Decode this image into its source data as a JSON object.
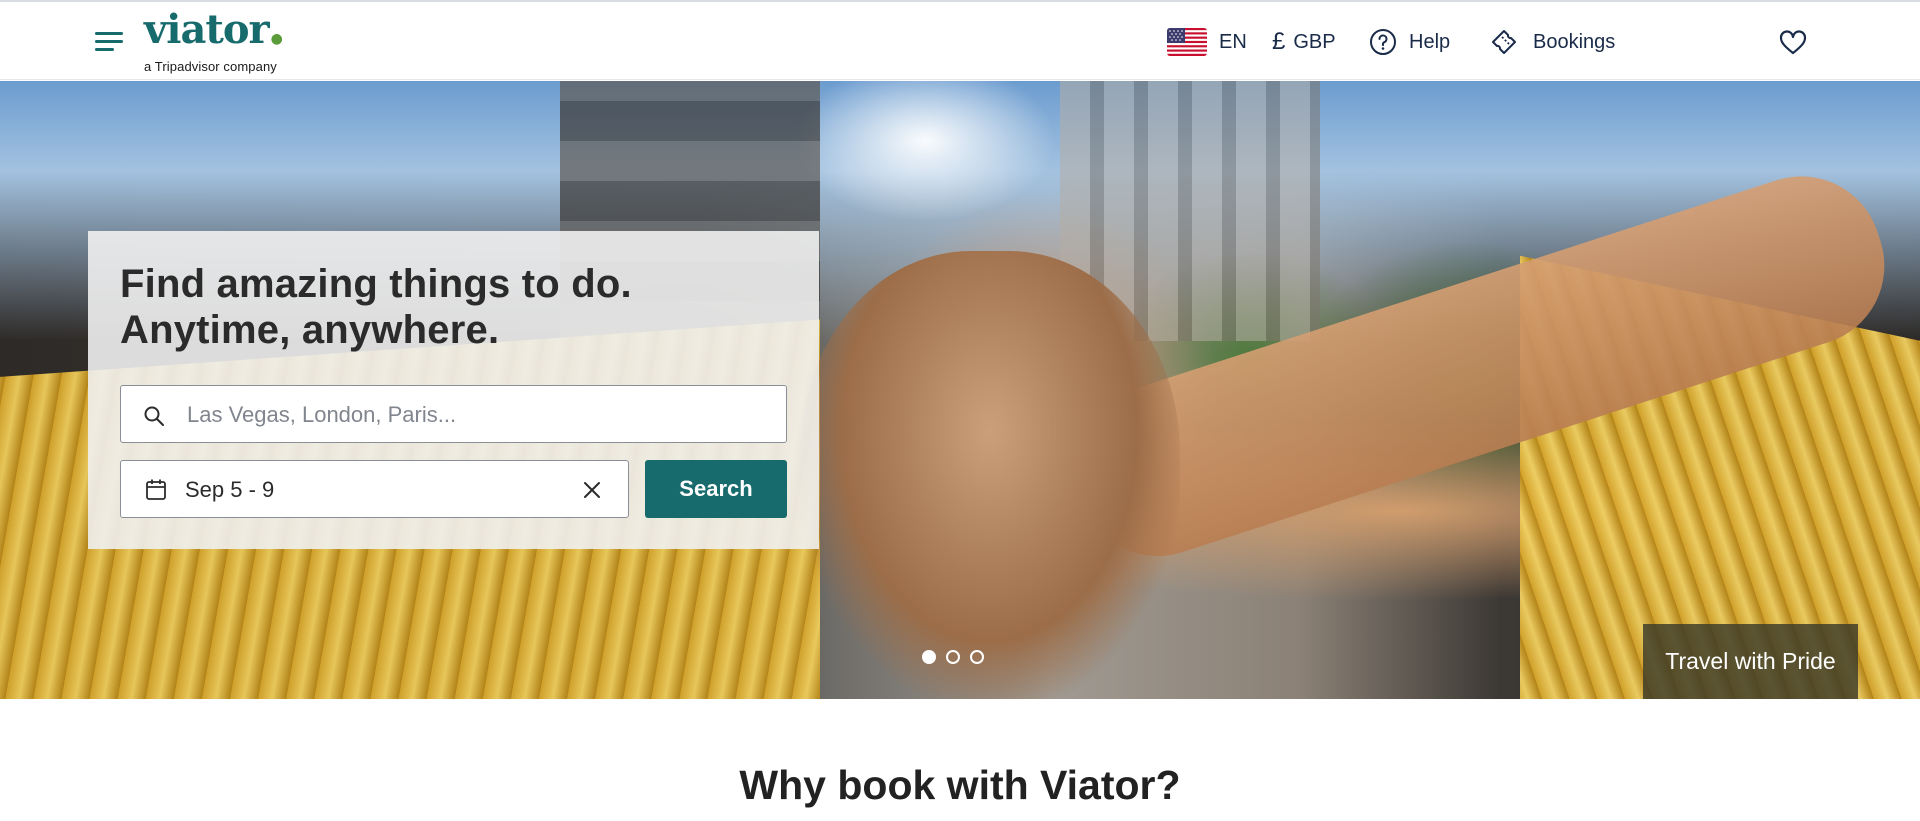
{
  "header": {
    "menu_icon": "hamburger-menu-icon",
    "logo_text": "viator",
    "logo_tagline": "a Tripadvisor company",
    "language": {
      "flag": "us-flag-icon",
      "label": "EN"
    },
    "currency": {
      "symbol": "£",
      "label": "GBP"
    },
    "help": {
      "icon": "question-circle-icon",
      "label": "Help"
    },
    "bookings": {
      "icon": "ticket-icon",
      "label": "Bookings"
    },
    "wishlist_icon": "heart-icon"
  },
  "hero": {
    "headline_line1": "Find amazing things to do.",
    "headline_line2": "Anytime, anywhere.",
    "search": {
      "placeholder": "Las Vegas, London, Paris...",
      "value": "",
      "icon": "search-icon"
    },
    "dates": {
      "icon": "calendar-icon",
      "value": "Sep 5 - 9",
      "clear_icon": "close-icon"
    },
    "search_button_label": "Search",
    "carousel": {
      "slide_count": 3,
      "active_index": 0
    },
    "badge_label": "Travel with Pride"
  },
  "section": {
    "why_title": "Why book with Viator?"
  },
  "colors": {
    "brand": "#186b6d",
    "text": "#1a2b49"
  }
}
